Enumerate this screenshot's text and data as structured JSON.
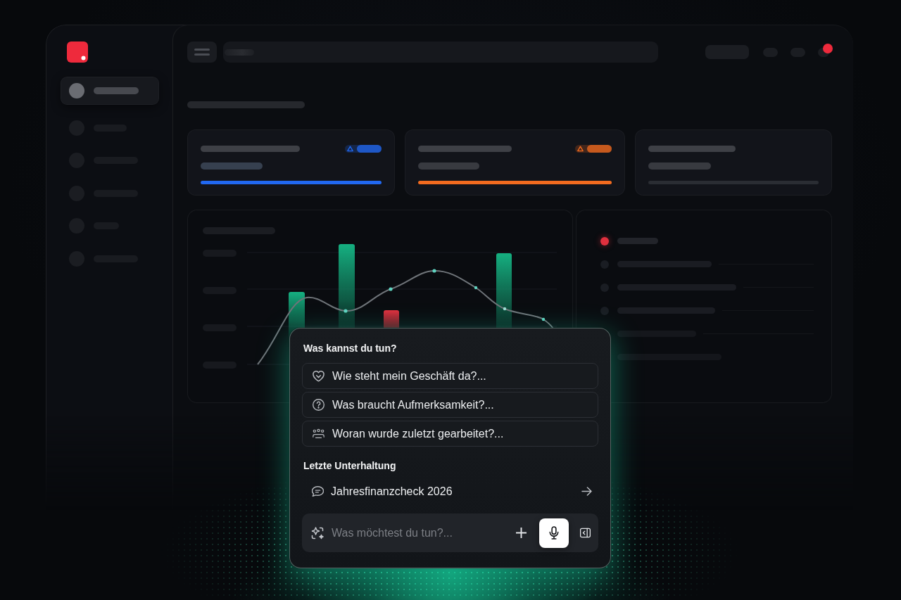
{
  "sidebar": {
    "items": [
      {
        "selected": true
      },
      {
        "selected": false
      },
      {
        "selected": false
      },
      {
        "selected": false
      },
      {
        "selected": false
      },
      {
        "selected": false
      }
    ]
  },
  "top_bar": {
    "notification": {
      "unread": true
    }
  },
  "cards": [
    {
      "color": "#2168f0",
      "alert": true
    },
    {
      "color": "#f26b1f",
      "alert": true
    },
    {
      "color": "#2a2d33",
      "alert": false
    }
  ],
  "status_list": {
    "items": [
      {
        "color": "#e0303e"
      },
      {
        "color": "#1a1d23"
      },
      {
        "color": "#1a1d23"
      },
      {
        "color": "#1a1d23"
      }
    ]
  },
  "assistant": {
    "suggestions_heading": "Was kannst du tun?",
    "suggestions": [
      {
        "kind": "heart",
        "label": "Wie steht mein Geschäft da?..."
      },
      {
        "kind": "question",
        "label": "Was braucht Aufmerksamkeit?..."
      },
      {
        "kind": "team",
        "label": "Woran wurde zuletzt gearbeitet?..."
      }
    ],
    "recent_heading": "Letzte Unterhaltung",
    "recent": {
      "title": "Jahresfinanzcheck 2026"
    },
    "input": {
      "placeholder": "Was möchtest du tun?...",
      "actions": [
        {
          "kind": "add",
          "active": false
        },
        {
          "kind": "mic",
          "active": true
        },
        {
          "kind": "panel",
          "active": false
        }
      ]
    }
  }
}
